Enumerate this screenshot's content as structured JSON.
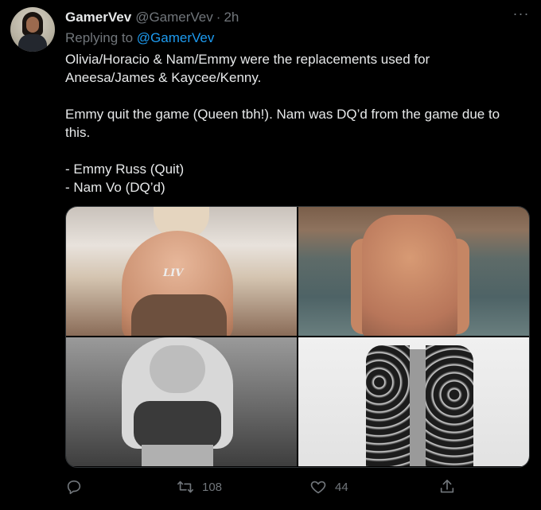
{
  "tweet": {
    "author_name": "GamerVev",
    "author_handle": "@GamerVev",
    "separator": "·",
    "time": "2h",
    "more_glyph": "···",
    "reply_prefix": "Replying to",
    "reply_to": "@GamerVev",
    "lines": [
      "Olivia/Horacio & Nam/Emmy were the replacements used for",
      "Aneesa/James & Kaycee/Kenny.",
      "",
      "Emmy quit the game (Queen tbh!). Nam was DQ’d from the game due to",
      "this.",
      "",
      "- Emmy Russ (Quit)",
      "- Nam Vo (DQ’d)"
    ],
    "media_text": {
      "necklace": "LIV"
    }
  },
  "actions": {
    "reply_icon": "reply-icon",
    "retweet_icon": "retweet-icon",
    "retweet_count": "108",
    "like_icon": "heart-icon",
    "like_count": "44",
    "share_icon": "share-icon"
  },
  "colors": {
    "background": "#000000",
    "text": "#e7e9ea",
    "muted": "#71767b",
    "link": "#1d9bf0"
  }
}
